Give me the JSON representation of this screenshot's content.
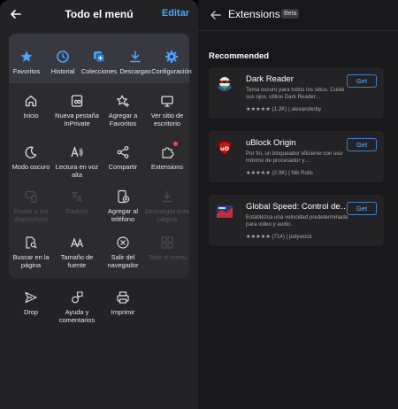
{
  "menu": {
    "title": "Todo el menú",
    "edit_label": "Editar",
    "favorites_row": [
      {
        "label": "Favoritos",
        "icon": "star-icon"
      },
      {
        "label": "Historial",
        "icon": "history-icon"
      },
      {
        "label": "Colecciones",
        "icon": "collections-icon"
      },
      {
        "label": "Descargas",
        "icon": "download-icon"
      },
      {
        "label": "Configuración",
        "icon": "gear-icon"
      }
    ],
    "grid": [
      {
        "label": "Inicio",
        "icon": "home-icon",
        "disabled": false
      },
      {
        "label": "Nueva pestaña InPrivate",
        "icon": "inprivate-tab-icon",
        "disabled": false
      },
      {
        "label": "Agregar a Favoritos",
        "icon": "star-add-icon",
        "disabled": false
      },
      {
        "label": "Ver sitio de escritorio",
        "icon": "desktop-icon",
        "disabled": false
      },
      {
        "label": "Modo oscuro",
        "icon": "moon-icon",
        "disabled": false
      },
      {
        "label": "Lectura en voz alta",
        "icon": "read-aloud-icon",
        "disabled": false
      },
      {
        "label": "Compartir",
        "icon": "share-icon",
        "disabled": false
      },
      {
        "label": "Extensions",
        "icon": "puzzle-icon",
        "disabled": false
      },
      {
        "label": "Enviar a los dispositivos",
        "icon": "send-devices-icon",
        "disabled": true
      },
      {
        "label": "Traducir",
        "icon": "translate-icon",
        "disabled": true
      },
      {
        "label": "Agregar al teléfono",
        "icon": "add-phone-icon",
        "disabled": false
      },
      {
        "label": "Descargar esta página",
        "icon": "download-page-icon",
        "disabled": true
      },
      {
        "label": "Buscar en la página",
        "icon": "find-in-page-icon",
        "disabled": false
      },
      {
        "label": "Tamaño de fuente",
        "icon": "font-size-icon",
        "disabled": false
      },
      {
        "label": "Salir del navegador",
        "icon": "exit-icon",
        "disabled": false
      },
      {
        "label": "Todo el menú",
        "icon": "all-menu-icon",
        "disabled": true
      }
    ],
    "bottom_row": [
      {
        "label": "Drop",
        "icon": "drop-icon"
      },
      {
        "label": "Ayuda y comentarios",
        "icon": "feedback-icon"
      },
      {
        "label": "Imprimir",
        "icon": "print-icon"
      }
    ],
    "accent_color": "#4aa3ff",
    "notification_dot_color": "#f0485a"
  },
  "extensions": {
    "title": "Extensions",
    "badge": "Beta",
    "section_title": "Recommended",
    "items": [
      {
        "name": "Dark Reader",
        "description": "Tema oscuro para todos los sitios. Cuide sus ojos, utilice Dark Reader…",
        "rating": "★★★★★",
        "reviews": "(1.2K)",
        "author": "alexanderby",
        "button": "Get",
        "icon": "dark-reader-icon"
      },
      {
        "name": "uBlock Origin",
        "description": "Por fin, un bloqueador eficiente con uso mínimo de procesador y…",
        "rating": "★★★★★",
        "reviews": "(2.0K)",
        "author": "Nik Rolls",
        "button": "Get",
        "icon": "ublock-icon"
      },
      {
        "name": "Global Speed: Control de…",
        "description": "Establezca una velocidad predeterminada para video y audio.",
        "rating": "★★★★★",
        "reviews": "(714)",
        "author": "polywock",
        "button": "Get",
        "icon": "global-speed-icon"
      }
    ]
  }
}
